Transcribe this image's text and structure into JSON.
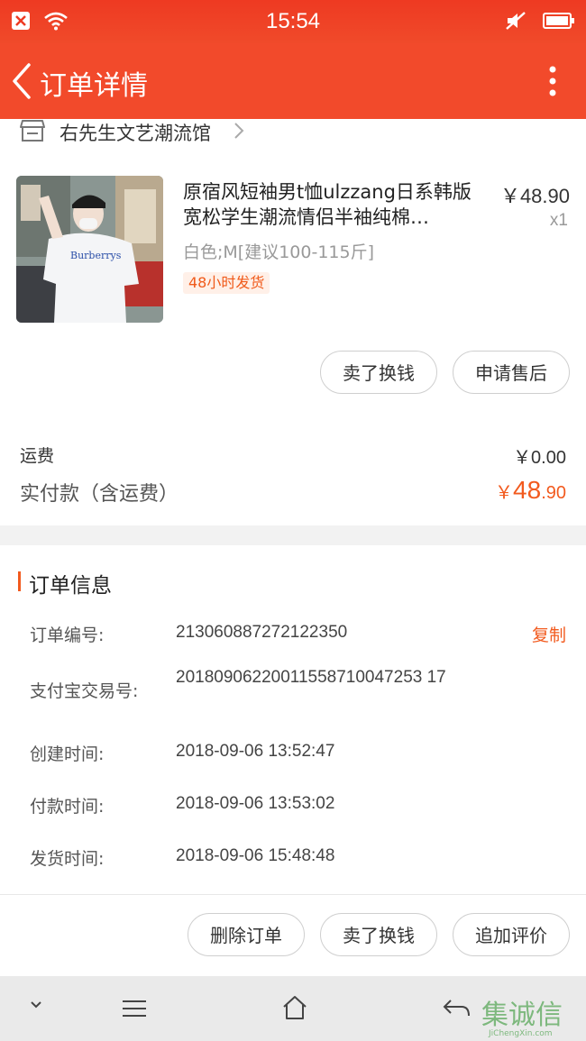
{
  "status_bar": {
    "time": "15:54"
  },
  "nav": {
    "title": "订单详情"
  },
  "shop": {
    "name": "右先生文艺潮流馆"
  },
  "product": {
    "title": "原宿风短袖男t恤ulzzang日系韩版宽松学生潮流情侣半袖纯棉…",
    "price": "￥48.90",
    "qty": "x1",
    "sku": "白色;M[建议100-115斤]",
    "tag": "48小时发货",
    "shirt_text": "Burberrys"
  },
  "item_actions": {
    "sell": "卖了换钱",
    "after_sale": "申请售后"
  },
  "summary": {
    "fee_label": "运费",
    "fee_value": "￥0.00",
    "paid_label": "实付款（含运费）",
    "paid_symbol": "￥",
    "paid_int": "48",
    "paid_dec": ".90"
  },
  "order_info": {
    "title": "订单信息",
    "copy": "复制",
    "rows": [
      {
        "label": "订单编号:",
        "value": "213060887272122350"
      },
      {
        "label": "支付宝交易号:",
        "value": "20180906220011558710047253 17"
      },
      {
        "label": "创建时间:",
        "value": "2018-09-06 13:52:47"
      },
      {
        "label": "付款时间:",
        "value": "2018-09-06 13:53:02"
      },
      {
        "label": "发货时间:",
        "value": "2018-09-06 15:48:48"
      }
    ]
  },
  "bottom_actions": {
    "delete": "删除订单",
    "sell": "卖了换钱",
    "review": "追加评价"
  },
  "watermark": {
    "cn": "集诚信",
    "en": "JiChengXin.com"
  },
  "colors": {
    "primary": "#f24a2b",
    "accent": "#f25a1e"
  }
}
